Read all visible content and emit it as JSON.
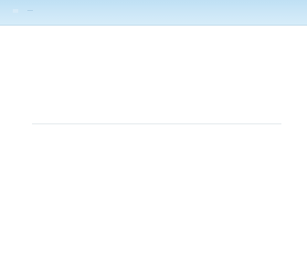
{
  "header": {
    "logo_text": "—"
  },
  "notice": {
    "title": "",
    "text": ""
  },
  "footer": {
    "links_text": "",
    "note": ""
  }
}
